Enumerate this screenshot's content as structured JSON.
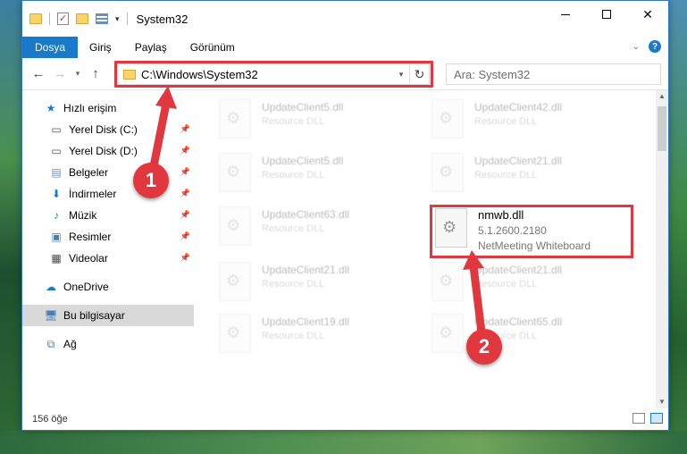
{
  "window": {
    "title": "System32"
  },
  "ribbon": {
    "tabs": [
      "Dosya",
      "Giriş",
      "Paylaş",
      "Görünüm"
    ]
  },
  "navbar": {
    "address": "C:\\Windows\\System32",
    "search_placeholder": "Ara: System32"
  },
  "sidebar": {
    "items": [
      {
        "label": "Hızlı erişim",
        "icon": "star-icon"
      },
      {
        "label": "Yerel Disk (C:)",
        "icon": "drive-icon"
      },
      {
        "label": "Yerel Disk (D:)",
        "icon": "drive-icon"
      },
      {
        "label": "Belgeler",
        "icon": "documents-icon"
      },
      {
        "label": "İndirmeler",
        "icon": "download-icon"
      },
      {
        "label": "Müzik",
        "icon": "music-icon"
      },
      {
        "label": "Resimler",
        "icon": "pictures-icon"
      },
      {
        "label": "Videolar",
        "icon": "video-icon"
      },
      {
        "label": "OneDrive",
        "icon": "cloud-icon"
      },
      {
        "label": "Bu bilgisayar",
        "icon": "computer-icon"
      },
      {
        "label": "Ağ",
        "icon": "network-icon"
      }
    ]
  },
  "files": [
    {
      "name": "UpdateClient5.dll",
      "desc": "Resource DLL"
    },
    {
      "name": "UpdateClient42.dll",
      "desc": "Resource DLL"
    },
    {
      "name": "UpdateClient5.dll",
      "desc": "Resource DLL"
    },
    {
      "name": "UpdateClient21.dll",
      "desc": "Resource DLL"
    },
    {
      "name": "UpdateClient63.dll",
      "desc": "Resource DLL"
    },
    {
      "name": "nmwb.dll",
      "version": "5.1.2600.2180",
      "desc": "NetMeeting Whiteboard"
    },
    {
      "name": "UpdateClient21.dll",
      "desc": "Resource DLL"
    },
    {
      "name": "UpdateClient21.dll",
      "desc": "Resource DLL"
    },
    {
      "name": "UpdateClient19.dll",
      "desc": "Resource DLL"
    },
    {
      "name": "UpdateClient65.dll",
      "desc": "Resource DLL"
    }
  ],
  "status": {
    "item_count": "156 öğe"
  },
  "callouts": [
    "1",
    "2"
  ],
  "colors": {
    "accent": "#1979ca",
    "highlight": "#e0383e"
  }
}
